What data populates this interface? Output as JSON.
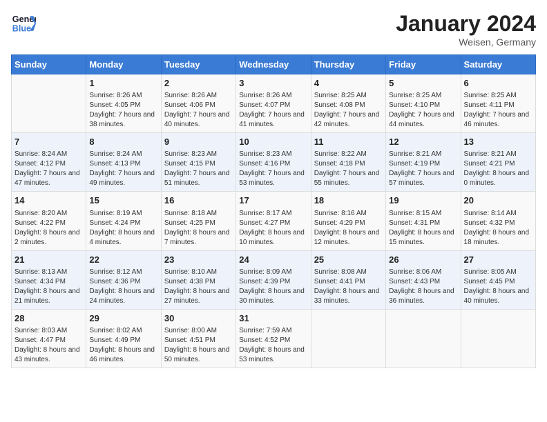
{
  "header": {
    "logo_line1": "General",
    "logo_line2": "Blue",
    "month_year": "January 2024",
    "location": "Weisen, Germany"
  },
  "weekdays": [
    "Sunday",
    "Monday",
    "Tuesday",
    "Wednesday",
    "Thursday",
    "Friday",
    "Saturday"
  ],
  "weeks": [
    [
      {
        "day": "",
        "sunrise": "",
        "sunset": "",
        "daylight": ""
      },
      {
        "day": "1",
        "sunrise": "Sunrise: 8:26 AM",
        "sunset": "Sunset: 4:05 PM",
        "daylight": "Daylight: 7 hours and 38 minutes."
      },
      {
        "day": "2",
        "sunrise": "Sunrise: 8:26 AM",
        "sunset": "Sunset: 4:06 PM",
        "daylight": "Daylight: 7 hours and 40 minutes."
      },
      {
        "day": "3",
        "sunrise": "Sunrise: 8:26 AM",
        "sunset": "Sunset: 4:07 PM",
        "daylight": "Daylight: 7 hours and 41 minutes."
      },
      {
        "day": "4",
        "sunrise": "Sunrise: 8:25 AM",
        "sunset": "Sunset: 4:08 PM",
        "daylight": "Daylight: 7 hours and 42 minutes."
      },
      {
        "day": "5",
        "sunrise": "Sunrise: 8:25 AM",
        "sunset": "Sunset: 4:10 PM",
        "daylight": "Daylight: 7 hours and 44 minutes."
      },
      {
        "day": "6",
        "sunrise": "Sunrise: 8:25 AM",
        "sunset": "Sunset: 4:11 PM",
        "daylight": "Daylight: 7 hours and 46 minutes."
      }
    ],
    [
      {
        "day": "7",
        "sunrise": "Sunrise: 8:24 AM",
        "sunset": "Sunset: 4:12 PM",
        "daylight": "Daylight: 7 hours and 47 minutes."
      },
      {
        "day": "8",
        "sunrise": "Sunrise: 8:24 AM",
        "sunset": "Sunset: 4:13 PM",
        "daylight": "Daylight: 7 hours and 49 minutes."
      },
      {
        "day": "9",
        "sunrise": "Sunrise: 8:23 AM",
        "sunset": "Sunset: 4:15 PM",
        "daylight": "Daylight: 7 hours and 51 minutes."
      },
      {
        "day": "10",
        "sunrise": "Sunrise: 8:23 AM",
        "sunset": "Sunset: 4:16 PM",
        "daylight": "Daylight: 7 hours and 53 minutes."
      },
      {
        "day": "11",
        "sunrise": "Sunrise: 8:22 AM",
        "sunset": "Sunset: 4:18 PM",
        "daylight": "Daylight: 7 hours and 55 minutes."
      },
      {
        "day": "12",
        "sunrise": "Sunrise: 8:21 AM",
        "sunset": "Sunset: 4:19 PM",
        "daylight": "Daylight: 7 hours and 57 minutes."
      },
      {
        "day": "13",
        "sunrise": "Sunrise: 8:21 AM",
        "sunset": "Sunset: 4:21 PM",
        "daylight": "Daylight: 8 hours and 0 minutes."
      }
    ],
    [
      {
        "day": "14",
        "sunrise": "Sunrise: 8:20 AM",
        "sunset": "Sunset: 4:22 PM",
        "daylight": "Daylight: 8 hours and 2 minutes."
      },
      {
        "day": "15",
        "sunrise": "Sunrise: 8:19 AM",
        "sunset": "Sunset: 4:24 PM",
        "daylight": "Daylight: 8 hours and 4 minutes."
      },
      {
        "day": "16",
        "sunrise": "Sunrise: 8:18 AM",
        "sunset": "Sunset: 4:25 PM",
        "daylight": "Daylight: 8 hours and 7 minutes."
      },
      {
        "day": "17",
        "sunrise": "Sunrise: 8:17 AM",
        "sunset": "Sunset: 4:27 PM",
        "daylight": "Daylight: 8 hours and 10 minutes."
      },
      {
        "day": "18",
        "sunrise": "Sunrise: 8:16 AM",
        "sunset": "Sunset: 4:29 PM",
        "daylight": "Daylight: 8 hours and 12 minutes."
      },
      {
        "day": "19",
        "sunrise": "Sunrise: 8:15 AM",
        "sunset": "Sunset: 4:31 PM",
        "daylight": "Daylight: 8 hours and 15 minutes."
      },
      {
        "day": "20",
        "sunrise": "Sunrise: 8:14 AM",
        "sunset": "Sunset: 4:32 PM",
        "daylight": "Daylight: 8 hours and 18 minutes."
      }
    ],
    [
      {
        "day": "21",
        "sunrise": "Sunrise: 8:13 AM",
        "sunset": "Sunset: 4:34 PM",
        "daylight": "Daylight: 8 hours and 21 minutes."
      },
      {
        "day": "22",
        "sunrise": "Sunrise: 8:12 AM",
        "sunset": "Sunset: 4:36 PM",
        "daylight": "Daylight: 8 hours and 24 minutes."
      },
      {
        "day": "23",
        "sunrise": "Sunrise: 8:10 AM",
        "sunset": "Sunset: 4:38 PM",
        "daylight": "Daylight: 8 hours and 27 minutes."
      },
      {
        "day": "24",
        "sunrise": "Sunrise: 8:09 AM",
        "sunset": "Sunset: 4:39 PM",
        "daylight": "Daylight: 8 hours and 30 minutes."
      },
      {
        "day": "25",
        "sunrise": "Sunrise: 8:08 AM",
        "sunset": "Sunset: 4:41 PM",
        "daylight": "Daylight: 8 hours and 33 minutes."
      },
      {
        "day": "26",
        "sunrise": "Sunrise: 8:06 AM",
        "sunset": "Sunset: 4:43 PM",
        "daylight": "Daylight: 8 hours and 36 minutes."
      },
      {
        "day": "27",
        "sunrise": "Sunrise: 8:05 AM",
        "sunset": "Sunset: 4:45 PM",
        "daylight": "Daylight: 8 hours and 40 minutes."
      }
    ],
    [
      {
        "day": "28",
        "sunrise": "Sunrise: 8:03 AM",
        "sunset": "Sunset: 4:47 PM",
        "daylight": "Daylight: 8 hours and 43 minutes."
      },
      {
        "day": "29",
        "sunrise": "Sunrise: 8:02 AM",
        "sunset": "Sunset: 4:49 PM",
        "daylight": "Daylight: 8 hours and 46 minutes."
      },
      {
        "day": "30",
        "sunrise": "Sunrise: 8:00 AM",
        "sunset": "Sunset: 4:51 PM",
        "daylight": "Daylight: 8 hours and 50 minutes."
      },
      {
        "day": "31",
        "sunrise": "Sunrise: 7:59 AM",
        "sunset": "Sunset: 4:52 PM",
        "daylight": "Daylight: 8 hours and 53 minutes."
      },
      {
        "day": "",
        "sunrise": "",
        "sunset": "",
        "daylight": ""
      },
      {
        "day": "",
        "sunrise": "",
        "sunset": "",
        "daylight": ""
      },
      {
        "day": "",
        "sunrise": "",
        "sunset": "",
        "daylight": ""
      }
    ]
  ]
}
